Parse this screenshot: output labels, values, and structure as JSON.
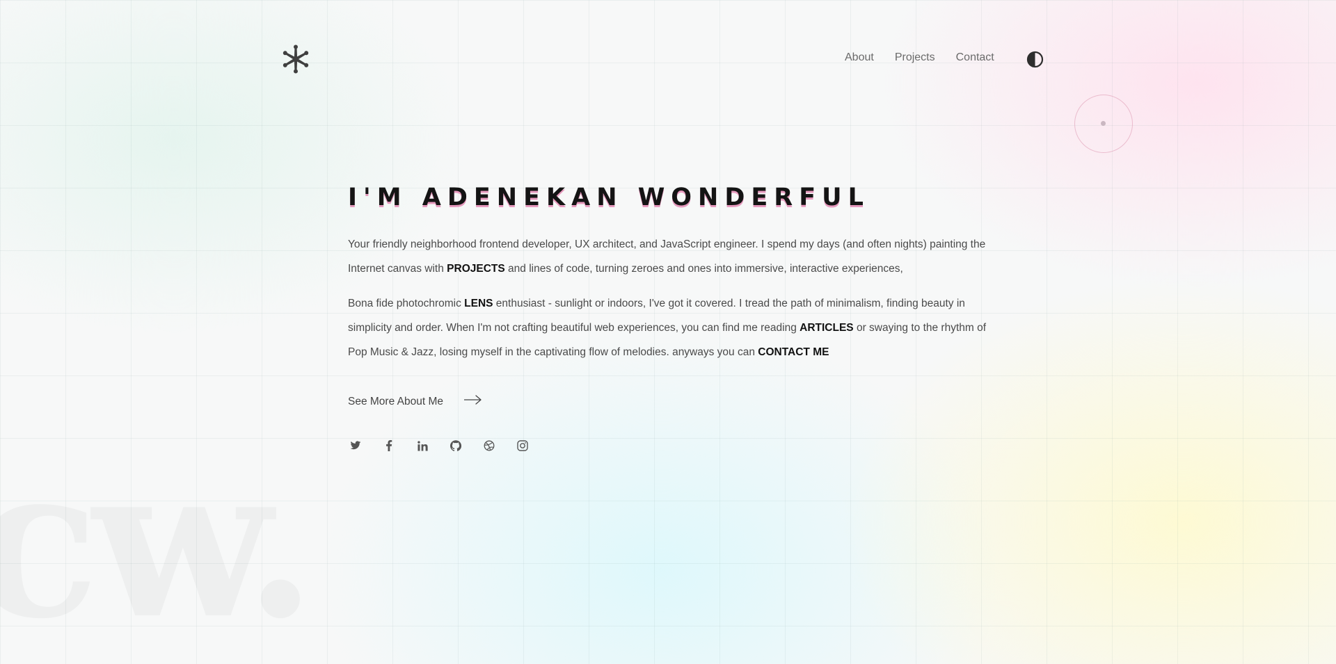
{
  "header": {
    "logo_icon": "asterisk-logo-icon",
    "nav": [
      {
        "label": "About"
      },
      {
        "label": "Projects"
      },
      {
        "label": "Contact"
      }
    ],
    "theme_toggle_icon": "contrast-icon"
  },
  "hero": {
    "heading": "I'M ADENEKAN WONDERFUL",
    "paragraph1": {
      "part1": "Your friendly neighborhood frontend developer, UX architect, and JavaScript engineer. I spend my days (and often nights) painting the Internet canvas with ",
      "link1": "PROJECTS",
      "part2": " and lines of code, turning zeroes and ones into immersive, interactive experiences,"
    },
    "paragraph2": {
      "part1": "Bona fide photochromic ",
      "link1": "LENS",
      "part2": " enthusiast - sunlight or indoors, I've got it covered. I tread the path of minimalism, finding beauty in simplicity and order. When I'm not crafting beautiful web experiences, you can find me reading ",
      "link2": "ARTICLES",
      "part3": " or swaying to the rhythm of Pop Music & Jazz, losing myself in the captivating flow of melodies. anyways you can ",
      "link3": "CONTACT ME"
    },
    "more_label": "See More About Me",
    "more_icon": "arrow-right-icon"
  },
  "social": [
    {
      "icon": "twitter-icon"
    },
    {
      "icon": "facebook-icon"
    },
    {
      "icon": "linkedin-icon"
    },
    {
      "icon": "github-icon"
    },
    {
      "icon": "dribbble-icon"
    },
    {
      "icon": "instagram-icon"
    }
  ],
  "watermark": "cw.",
  "colors": {
    "accent": "#d2287a",
    "text": "#3a3a3a",
    "heading": "#141414"
  }
}
